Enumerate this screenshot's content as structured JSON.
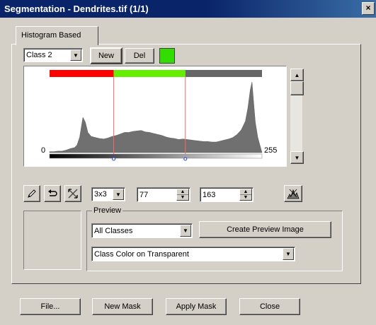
{
  "window": {
    "title": "Segmentation - Dendrites.tif (1/1)",
    "close_glyph": "×"
  },
  "tabs": [
    {
      "label": "Histogram Based"
    }
  ],
  "class_row": {
    "selected_class": "Class 2",
    "new_label": "New",
    "del_label": "Del",
    "class_color": "#33dd00"
  },
  "histogram": {
    "min_label": "0",
    "max_label": "255",
    "class_bands": [
      {
        "from": 0,
        "to": 77,
        "color": "#ff0000"
      },
      {
        "from": 77,
        "to": 163,
        "color": "#66ee00"
      },
      {
        "from": 163,
        "to": 255,
        "color": "#666666"
      }
    ],
    "thresholds": [
      77,
      163
    ],
    "threshold_color": "#ff6666",
    "profile": [
      [
        0,
        2
      ],
      [
        5,
        2
      ],
      [
        10,
        3
      ],
      [
        15,
        3
      ],
      [
        20,
        5
      ],
      [
        25,
        8
      ],
      [
        30,
        10
      ],
      [
        33,
        15
      ],
      [
        36,
        30
      ],
      [
        40,
        70
      ],
      [
        43,
        60
      ],
      [
        46,
        40
      ],
      [
        50,
        32
      ],
      [
        55,
        30
      ],
      [
        60,
        28
      ],
      [
        65,
        27
      ],
      [
        70,
        29
      ],
      [
        75,
        32
      ],
      [
        80,
        34
      ],
      [
        85,
        37
      ],
      [
        90,
        40
      ],
      [
        95,
        40
      ],
      [
        100,
        42
      ],
      [
        105,
        43
      ],
      [
        110,
        44
      ],
      [
        115,
        41
      ],
      [
        120,
        40
      ],
      [
        125,
        38
      ],
      [
        130,
        36
      ],
      [
        135,
        34
      ],
      [
        140,
        31
      ],
      [
        145,
        29
      ],
      [
        150,
        28
      ],
      [
        155,
        26
      ],
      [
        160,
        27
      ],
      [
        165,
        26
      ],
      [
        170,
        25
      ],
      [
        175,
        24
      ],
      [
        180,
        23
      ],
      [
        185,
        22
      ],
      [
        190,
        22
      ],
      [
        195,
        21
      ],
      [
        200,
        21
      ],
      [
        205,
        23
      ],
      [
        210,
        25
      ],
      [
        215,
        27
      ],
      [
        220,
        30
      ],
      [
        225,
        36
      ],
      [
        230,
        45
      ],
      [
        235,
        62
      ],
      [
        238,
        88
      ],
      [
        241,
        125
      ],
      [
        243,
        140
      ],
      [
        245,
        100
      ],
      [
        247,
        60
      ],
      [
        250,
        30
      ],
      [
        255,
        0
      ]
    ]
  },
  "tools": {
    "kernel_size": "3x3",
    "lower_value": "77",
    "upper_value": "163"
  },
  "preview": {
    "legend": "Preview",
    "classes_selected": "All Classes",
    "create_preview_label": "Create Preview Image",
    "display_mode": "Class Color on Transparent"
  },
  "footer": {
    "file_label": "File...",
    "new_mask_label": "New Mask",
    "apply_mask_label": "Apply Mask",
    "close_label": "Close"
  }
}
